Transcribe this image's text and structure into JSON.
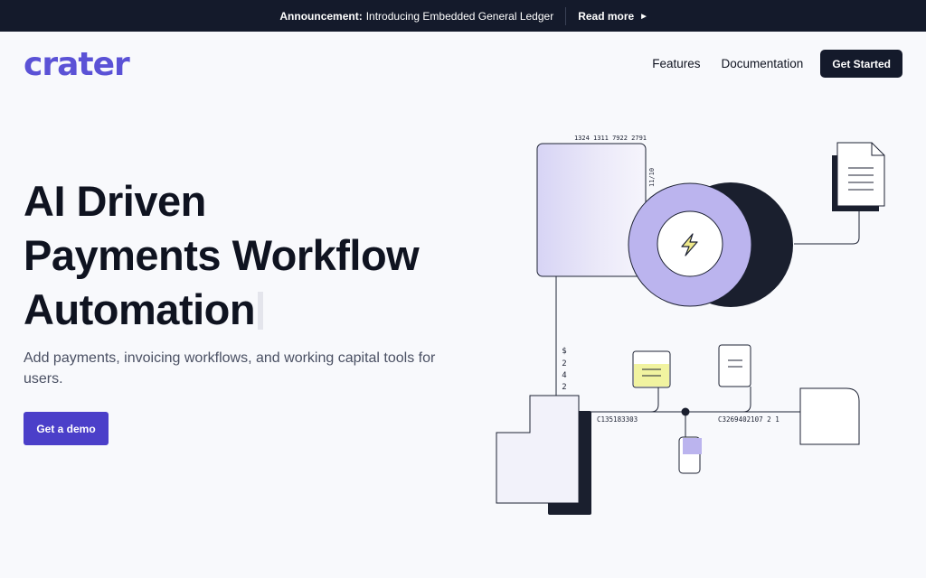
{
  "banner": {
    "label": "Announcement:",
    "text": "Introducing Embedded General Ledger",
    "link": "Read more"
  },
  "brand": {
    "logo_text": "crater",
    "accent_color": "#5b52d6"
  },
  "nav": {
    "features": "Features",
    "documentation": "Documentation",
    "cta": "Get Started"
  },
  "hero": {
    "title_lines": [
      "AI Driven",
      "Payments Workflow",
      "Automation"
    ],
    "subtitle": "Add payments, invoicing workflows, and working capital tools for users.",
    "cta": "Get a demo"
  },
  "illustration": {
    "card_number": "1324 1311 7922 2791",
    "expiry": "11/10",
    "amount_chars": [
      "$",
      "2",
      "4",
      "2"
    ],
    "ledger_left": "C135183303",
    "ledger_right": "C3269402107 2 1",
    "center_icon": "lightning-icon"
  }
}
